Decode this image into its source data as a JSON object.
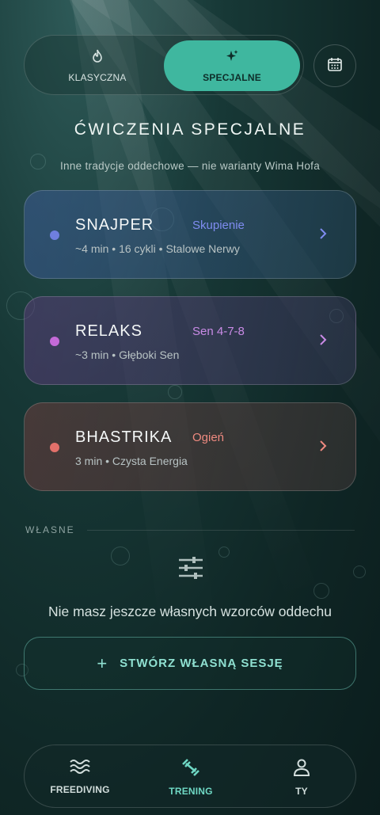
{
  "tabs": [
    {
      "label": "KLASYCZNA",
      "icon": "flame-icon"
    },
    {
      "label": "SPECJALNE",
      "icon": "sparkles-icon",
      "active": true
    }
  ],
  "calendar_icon": "calendar-icon",
  "title": "ĆWICZENIA SPECJALNE",
  "subtitle": "Inne tradycje oddechowe — nie warianty Wima Hofa",
  "exercises": [
    {
      "name": "SNAJPER",
      "tag": "Skupienie",
      "meta": "~4 min • 16 cykli • Stalowe Nerwy",
      "color": "#6f7fe0",
      "tag_color": "#7f8cf0"
    },
    {
      "name": "RELAKS",
      "tag": "Sen 4-7-8",
      "meta": "~3 min • Głęboki Sen",
      "color": "#c46ad8",
      "tag_color": "#c98be6"
    },
    {
      "name": "BHASTRIKA",
      "tag": "Ogień",
      "meta": "3 min • Czysta Energia",
      "color": "#e2706a",
      "tag_color": "#ef8a80"
    }
  ],
  "custom_section": {
    "label": "WŁASNE",
    "empty_text": "Nie masz jeszcze własnych wzorców oddechu",
    "create_label": "STWÓRZ WŁASNĄ SESJĘ"
  },
  "nav": [
    {
      "label": "FREEDIVING",
      "icon": "waves-icon"
    },
    {
      "label": "TRENING",
      "icon": "dumbbell-icon",
      "active": true
    },
    {
      "label": "TY",
      "icon": "user-icon"
    }
  ],
  "accent": "#3fb79f"
}
